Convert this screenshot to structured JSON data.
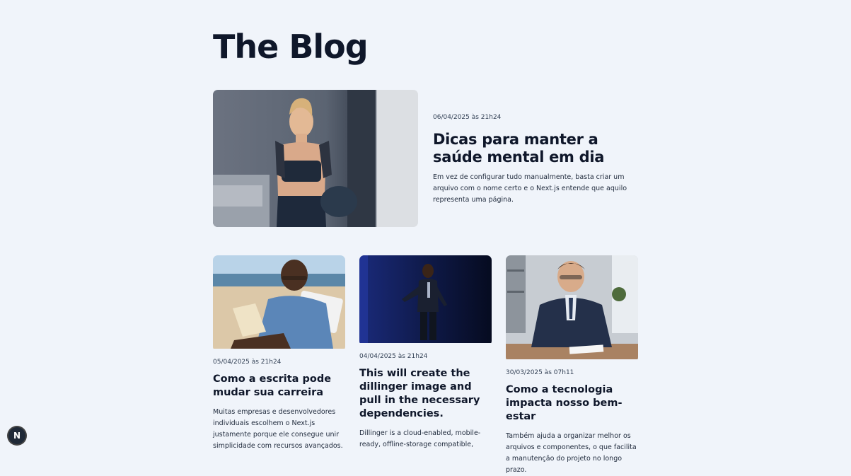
{
  "page": {
    "title": "The Blog"
  },
  "featured": {
    "date": "06/04/2025 às 21h24",
    "title": "Dicas para manter a saúde mental em dia",
    "excerpt": "Em vez de configurar tudo manualmente, basta criar um arquivo com o nome certo e o Next.js entende que aquilo representa uma página."
  },
  "posts": [
    {
      "date": "05/04/2025 às 21h24",
      "title": "Como a escrita pode mudar sua carreira",
      "excerpt": "Muitas empresas e desenvolvedores individuais escolhem o Next.js justamente porque ele consegue unir simplicidade com recursos avançados."
    },
    {
      "date": "04/04/2025 às 21h24",
      "title": "This will create the dillinger image and pull in the necessary dependencies.",
      "excerpt": "Dillinger is a cloud-enabled, mobile-ready, offline-storage compatible,"
    },
    {
      "date": "30/03/2025 às 07h11",
      "title": "Como a tecnologia impacta nosso bem-estar",
      "excerpt": "Também ajuda a organizar melhor os arquivos e componentes, o que facilita a manutenção do projeto no longo prazo."
    }
  ],
  "devtools": {
    "badge_label": "N"
  }
}
